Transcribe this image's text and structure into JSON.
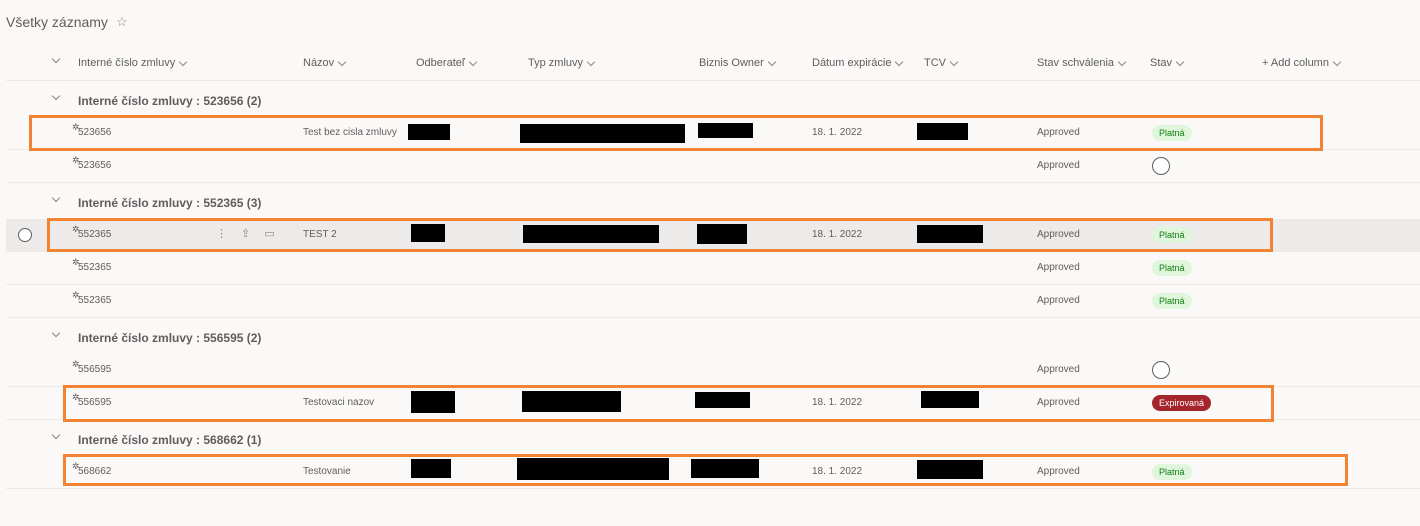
{
  "page": {
    "title": "Všetky záznamy",
    "star_icon": "star-icon"
  },
  "columns": {
    "id": "Interné číslo zmluvy",
    "name": "Názov",
    "customer": "Odberateľ",
    "type": "Typ zmluvy",
    "owner": "Biznis Owner",
    "expiry": "Dátum expirácie",
    "tcv": "TCV",
    "approval": "Stav schválenia",
    "status": "Stav",
    "add": "+ Add column"
  },
  "groups": [
    {
      "title": "Interné číslo zmluvy : 523656 (2)"
    },
    {
      "title": "Interné číslo zmluvy : 552365 (3)"
    },
    {
      "title": "Interné číslo zmluvy : 556595 (2)"
    },
    {
      "title": "Interné číslo zmluvy : 568662 (1)"
    }
  ],
  "rows": [
    {
      "id": "523656",
      "name": "Test bez cisla zmluvy",
      "expiry": "18. 1. 2022",
      "approval": "Approved",
      "status": "Platná"
    },
    {
      "id": "523656",
      "name": "",
      "expiry": "",
      "approval": "Approved",
      "status": ""
    },
    {
      "id": "552365",
      "name": "TEST 2",
      "expiry": "18. 1. 2022",
      "approval": "Approved",
      "status": "Platná"
    },
    {
      "id": "552365",
      "name": "",
      "expiry": "",
      "approval": "Approved",
      "status": "Platná"
    },
    {
      "id": "552365",
      "name": "",
      "expiry": "",
      "approval": "Approved",
      "status": "Platná"
    },
    {
      "id": "556595",
      "name": "",
      "expiry": "",
      "approval": "Approved",
      "status": ""
    },
    {
      "id": "556595",
      "name": "Testovaci nazov",
      "expiry": "18. 1. 2022",
      "approval": "Approved",
      "status": "Expirovaná"
    },
    {
      "id": "568662",
      "name": "Testovanie",
      "expiry": "18. 1. 2022",
      "approval": "Approved",
      "status": "Platná"
    }
  ],
  "colors": {
    "highlight": "#f08433",
    "badge_ok": "#dff6dd",
    "badge_expired": "#a4262c"
  }
}
